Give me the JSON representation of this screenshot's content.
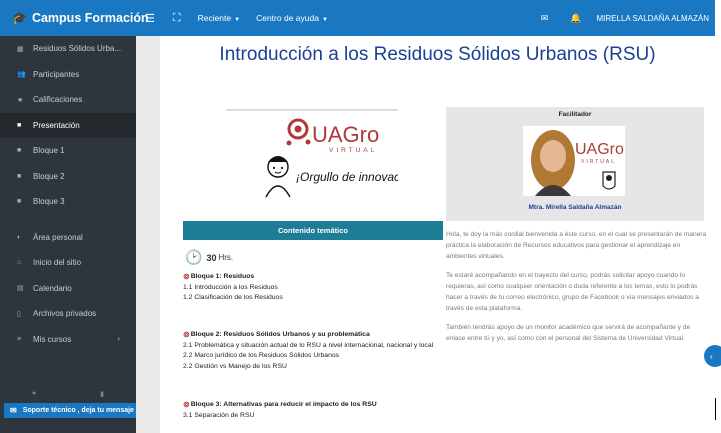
{
  "navbar": {
    "brand": "Campus Formación",
    "links": [
      "Reciente",
      "Centro de ayuda"
    ],
    "user": "MIRELLA SALDAÑA ALMAZÁN",
    "icons": {
      "brand": "graduation-cap-icon",
      "menu": "hamburger-icon",
      "fullscreen": "expand-icon",
      "messages": "envelope-icon",
      "notifications": "bell-icon"
    }
  },
  "sidebar": {
    "items": [
      {
        "label": "Residuos Sólidos Urba...",
        "icon": "table-icon"
      },
      {
        "label": "Participantes",
        "icon": "users-icon"
      },
      {
        "label": "Calificaciones",
        "icon": "star-icon"
      },
      {
        "label": "Presentación",
        "icon": "folder-icon",
        "active": true
      },
      {
        "label": "Bloque 1",
        "icon": "folder-icon"
      },
      {
        "label": "Bloque 2",
        "icon": "folder-icon"
      },
      {
        "label": "Bloque 3",
        "icon": "folder-icon"
      }
    ],
    "items2": [
      {
        "label": "Área personal",
        "icon": "dashboard-icon"
      },
      {
        "label": "Inicio del sitio",
        "icon": "home-icon"
      },
      {
        "label": "Calendario",
        "icon": "calendar-icon"
      },
      {
        "label": "Archivos privados",
        "icon": "file-icon"
      },
      {
        "label": "Mis cursos",
        "icon": "graduation-icon"
      }
    ],
    "support": "Soporte técnico , deja tu mensaje"
  },
  "content": {
    "title": "Introducción a los Residuos Sólidos Urbanos (RSU)",
    "logo": {
      "brand": "UAGro",
      "sub": "VIRTUAL",
      "slogan": "¡Orgullo de innovación!"
    },
    "contenido_label": "Contenido temático",
    "hours_value": "30",
    "hours_unit": "Hrs.",
    "blocks": [
      {
        "title": "Bloque 1: Residuos",
        "items": [
          "1.1 Introducción a los Residuos",
          "1.2 Clasificación de los Residuos"
        ]
      },
      {
        "title": "Bloque 2: Residuos Sólidos Urbanos y su problemática",
        "items": [
          "2.1 Problemática y situación actual de lo RSU a nivel internacional, nacional y local",
          "2.2 Marco jurídico de los Residuos Sólidos Urbanos",
          "2.2 Gestión vs Manejo de los RSU"
        ]
      },
      {
        "title": "Bloque 3: Alternativas para reducir el impacto de los RSU",
        "items": [
          "3.1 Separación de RSU"
        ]
      }
    ],
    "facilitator": {
      "label": "Facilitador",
      "name": "Mtra. Mirella Saldaña Almazán",
      "logo_brand": "UAGro",
      "logo_sub": "VIRTUAL"
    },
    "paragraphs": [
      "Hola, te doy la más cordial bienvenida a éste curso, en el cual se presentarán de manera práctica la elaboración de Recursos educativos para gestionar el aprendizaje en ambientes virtuales.",
      "Te estaré acompañando en el trayecto del curso, podrás solicitar apoyo cuando lo requieras, así como cualquier orientación o duda referente a los temas, esto lo podrás hacer a través de tu correo electrónico, grupo de Facebook o vía mensajes enviados a través de esta plataforma.",
      "También tendrás apoyo de un monitor académico que servirá de acompañante y de enlace entre tú y yo, así como con el personal del Sistema de Universidad Virtual."
    ]
  },
  "colors": {
    "primary": "#1a78c2",
    "sidebar": "#2e353d",
    "title": "#1c3f94",
    "teal": "#1e7d96",
    "brand_red": "#b03a3a"
  }
}
